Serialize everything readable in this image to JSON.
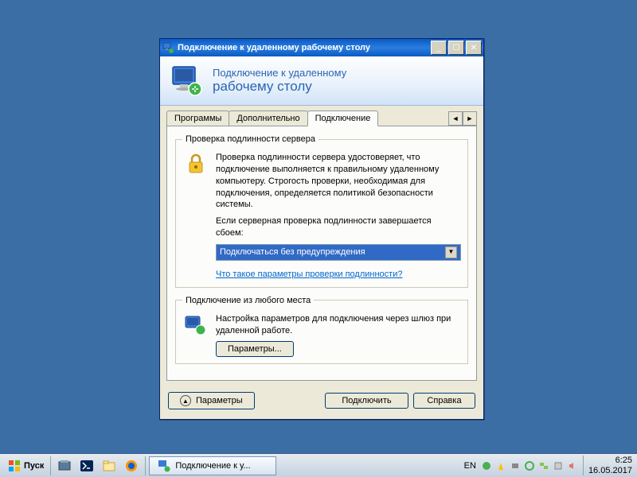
{
  "window": {
    "title": "Подключение к удаленному рабочему столу",
    "header_line1": "Подключение к удаленному",
    "header_line2": "рабочему столу"
  },
  "tabs": {
    "visible": [
      "Программы",
      "Дополнительно",
      "Подключение"
    ],
    "active_index": 2
  },
  "auth_group": {
    "legend": "Проверка подлинности сервера",
    "desc": "Проверка подлинности сервера удостоверяет, что подключение выполняется к правильному удаленному компьютеру. Строгость проверки, необходимая для подключения, определяется политикой безопасности системы.",
    "prompt": "Если серверная проверка подлинности завершается сбоем:",
    "combo_value": "Подключаться без предупреждения",
    "link": "Что такое параметры проверки подлинности?"
  },
  "anywhere_group": {
    "legend": "Подключение из любого места",
    "desc": "Настройка параметров для подключения через шлюз при удаленной работе.",
    "button": "Параметры..."
  },
  "footer": {
    "options": "Параметры",
    "connect": "Подключить",
    "help": "Справка"
  },
  "taskbar": {
    "start": "Пуск",
    "task_label": "Подключение к у...",
    "lang": "EN",
    "time": "6:25",
    "date": "16.05.2017"
  }
}
